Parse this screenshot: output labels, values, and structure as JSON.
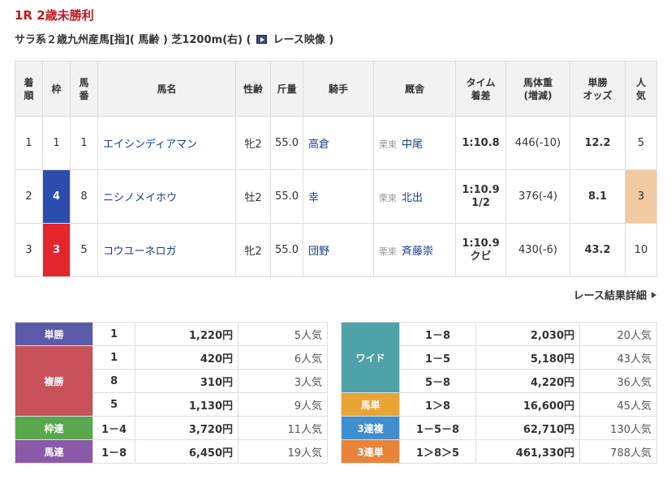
{
  "race": {
    "title": "1R 2歳未勝利",
    "conditions": "サラ系２歳九州産馬[指]( 馬齢 ) 芝1200m(右) (",
    "video_label": "レース映像",
    "conditions_close": ")"
  },
  "result": {
    "headers": {
      "rank": [
        "着",
        "順"
      ],
      "waku": "枠",
      "umaban": [
        "馬",
        "番"
      ],
      "horse": "馬名",
      "sexage": "性齢",
      "weight": "斤量",
      "jockey": "騎手",
      "trainer": "厩舎",
      "time": [
        "タイム",
        "着差"
      ],
      "body": [
        "馬体重",
        "(増減)"
      ],
      "odds": [
        "単勝",
        "オッズ"
      ],
      "pop": [
        "人",
        "気"
      ]
    },
    "rows": [
      {
        "rank": "1",
        "waku": "1",
        "umaban": "1",
        "horse": "エイシンディアマン",
        "sexage": "牝2",
        "weight": "55.0",
        "jockey": "高倉",
        "region": "栗東",
        "trainer": "中尾",
        "time": "1:10.8",
        "margin": "",
        "body": "446(-10)",
        "odds": "12.2",
        "pop": "5"
      },
      {
        "rank": "2",
        "waku": "4",
        "umaban": "8",
        "horse": "ニシノメイホウ",
        "sexage": "牡2",
        "weight": "55.0",
        "jockey": "幸",
        "region": "栗東",
        "trainer": "北出",
        "time": "1:10.9",
        "margin": "1/2",
        "body": "376(-4)",
        "odds": "8.1",
        "pop": "3"
      },
      {
        "rank": "3",
        "waku": "3",
        "umaban": "5",
        "horse": "コウユーネロガ",
        "sexage": "牝2",
        "weight": "55.0",
        "jockey": "団野",
        "region": "栗東",
        "trainer": "斉藤崇",
        "time": "1:10.9",
        "margin": "クビ",
        "body": "430(-6)",
        "odds": "43.2",
        "pop": "10"
      }
    ]
  },
  "detail_link": "レース結果詳細",
  "payouts": {
    "tansho": {
      "label": "単勝",
      "color": "#5b5aa8",
      "rows": [
        {
          "num": "1",
          "yen": "1,220円",
          "pop": "5人気"
        }
      ]
    },
    "fukusho": {
      "label": "複勝",
      "color": "#c9515a",
      "rows": [
        {
          "num": "1",
          "yen": "420円",
          "pop": "6人気"
        },
        {
          "num": "8",
          "yen": "310円",
          "pop": "3人気"
        },
        {
          "num": "5",
          "yen": "1,130円",
          "pop": "9人気"
        }
      ]
    },
    "wakuren": {
      "label": "枠連",
      "color": "#5aa84e",
      "rows": [
        {
          "num": "1－4",
          "yen": "3,720円",
          "pop": "11人気"
        }
      ]
    },
    "umaren": {
      "label": "馬連",
      "color": "#8a5aa8",
      "rows": [
        {
          "num": "1－8",
          "yen": "6,450円",
          "pop": "19人気"
        }
      ]
    },
    "wide": {
      "label": "ワイド",
      "color": "#4fa3a8",
      "rows": [
        {
          "num": "1－8",
          "yen": "2,030円",
          "pop": "20人気"
        },
        {
          "num": "1－5",
          "yen": "5,180円",
          "pop": "43人気"
        },
        {
          "num": "5－8",
          "yen": "4,220円",
          "pop": "36人気"
        }
      ]
    },
    "umatan": {
      "label": "馬単",
      "color": "#e8a534",
      "rows": [
        {
          "num": "1＞8",
          "yen": "16,600円",
          "pop": "45人気"
        }
      ]
    },
    "sanrenpuku": {
      "label": "3連複",
      "color": "#3f8fcf",
      "rows": [
        {
          "num": "1－5－8",
          "yen": "62,710円",
          "pop": "130人気"
        }
      ]
    },
    "sanrentan": {
      "label": "3連単",
      "color": "#e8843a",
      "rows": [
        {
          "num": "1＞8＞5",
          "yen": "461,330円",
          "pop": "788人気"
        }
      ]
    }
  }
}
